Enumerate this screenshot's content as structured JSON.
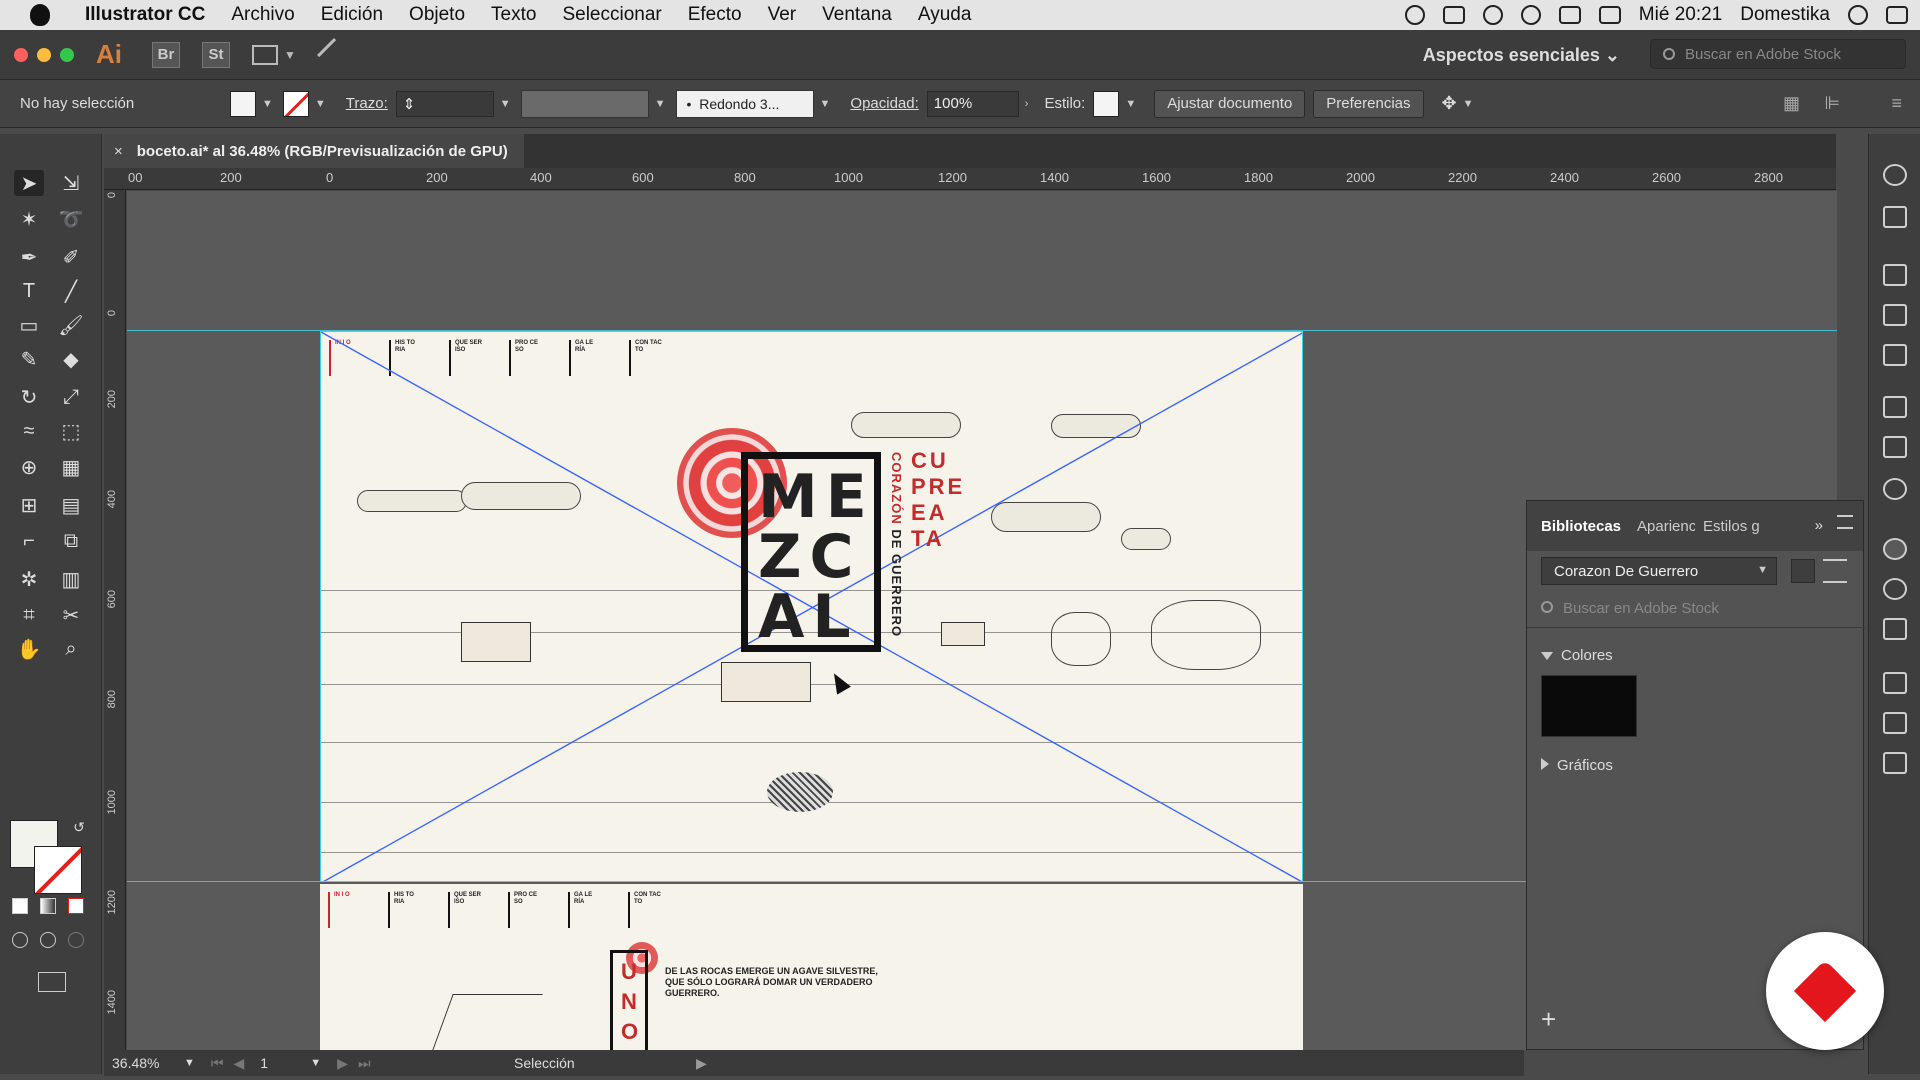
{
  "menubar": {
    "app_name": "Illustrator CC",
    "items": [
      "Archivo",
      "Edición",
      "Objeto",
      "Texto",
      "Seleccionar",
      "Efecto",
      "Ver",
      "Ventana",
      "Ayuda"
    ],
    "clock": "Mié 20:21",
    "user": "Domestika"
  },
  "titlebar": {
    "logo": "Ai",
    "bridge": "Br",
    "stock": "St",
    "workspace": "Aspectos esenciales",
    "stock_search_placeholder": "Buscar en Adobe Stock"
  },
  "controlbar": {
    "selection": "No hay selección",
    "stroke_label": "Trazo:",
    "brush": "Redondo 3...",
    "opacity_label": "Opacidad:",
    "opacity_value": "100%",
    "style_label": "Estilo:",
    "adjust_button": "Ajustar documento",
    "prefs_button": "Preferencias"
  },
  "document": {
    "tab_title": "boceto.ai* al 36.48% (RGB/Previsualización de GPU)",
    "close": "×"
  },
  "ruler_top": [
    "00",
    "200",
    "0",
    "200",
    "400",
    "600",
    "800",
    "1000",
    "1200",
    "1400",
    "1600",
    "1800",
    "2000",
    "2200",
    "2400",
    "2600",
    "2800"
  ],
  "ruler_left": [
    "0",
    "0",
    "200",
    "400",
    "600",
    "800",
    "1000",
    "1200",
    "1400"
  ],
  "artboard": {
    "nav": [
      "IN I O",
      "HIS TO RIA",
      "QUE SER ISO",
      "PRO CE SO",
      "GA LE RÍA",
      "CON TAC TO"
    ],
    "brand": "ME ZC AL",
    "variety": "CU PRE EA TA",
    "subtitle_a": "CORAZÓN",
    "subtitle_b": "DE",
    "subtitle_c": "GUERRERO"
  },
  "artboard2": {
    "nav": [
      "IN I O",
      "HIS TO RIA",
      "QUE SER ISO",
      "PRO CE SO",
      "GA LE RÍA",
      "CON TAC TO"
    ],
    "uno": "U N O",
    "text": "DE LAS ROCAS EMERGE UN AGAVE SILVESTRE, QUE SÓLO LOGRARÁ DOMAR UN VERDADERO GUERRERO."
  },
  "statusbar": {
    "zoom": "36.48%",
    "page": "1",
    "status": "Selección"
  },
  "libraries": {
    "tabs": [
      "Bibliotecas",
      "Aparienc",
      "Estilos g"
    ],
    "library_name": "Corazon De Guerrero",
    "search_placeholder": "Buscar en Adobe Stock",
    "section_colors": "Colores",
    "section_graphics": "Gráficos",
    "color_chip": "#0a0a0a"
  },
  "colors": {
    "accent_red": "#c42b2b",
    "guide": "#3ed4ee",
    "domestika": "#e3171b"
  }
}
